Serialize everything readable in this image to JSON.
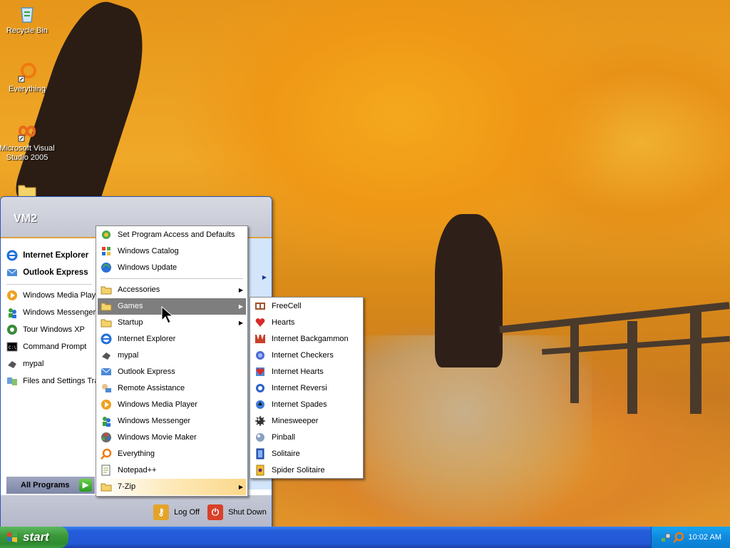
{
  "desktop": {
    "icons": [
      {
        "label": "Recycle Bin",
        "icon": "recycle-bin-icon"
      },
      {
        "label": "Everything",
        "icon": "everything-search-icon"
      },
      {
        "label": "Microsoft Visual Studio 2005",
        "icon": "visual-studio-icon"
      },
      {
        "label": "",
        "icon": "folder-icon"
      }
    ]
  },
  "start_menu": {
    "user": "VM2",
    "pinned": [
      {
        "label": "Internet Explorer",
        "icon": "internet-explorer-icon"
      },
      {
        "label": "Outlook Express",
        "icon": "outlook-express-icon"
      }
    ],
    "recent": [
      {
        "label": "Windows Media Player",
        "icon": "media-player-icon"
      },
      {
        "label": "Windows Messenger",
        "icon": "messenger-icon"
      },
      {
        "label": "Tour Windows XP",
        "icon": "tour-icon"
      },
      {
        "label": "Command Prompt",
        "icon": "command-prompt-icon"
      },
      {
        "label": "mypal",
        "icon": "mypal-icon"
      },
      {
        "label": "Files and Settings Transfer Wizard",
        "icon": "transfer-wizard-icon"
      }
    ],
    "all_programs": "All Programs",
    "log_off": "Log Off",
    "shut_down": "Shut Down"
  },
  "programs_menu": {
    "top": [
      {
        "label": "Set Program Access and Defaults",
        "icon": "program-access-icon"
      },
      {
        "label": "Windows Catalog",
        "icon": "windows-catalog-icon"
      },
      {
        "label": "Windows Update",
        "icon": "windows-update-icon"
      }
    ],
    "items": [
      {
        "label": "Accessories",
        "icon": "folder-icon",
        "submenu": true
      },
      {
        "label": "Games",
        "icon": "folder-icon",
        "submenu": true
      },
      {
        "label": "Startup",
        "icon": "folder-icon",
        "submenu": true
      },
      {
        "label": "Internet Explorer",
        "icon": "internet-explorer-icon"
      },
      {
        "label": "mypal",
        "icon": "mypal-icon"
      },
      {
        "label": "Outlook Express",
        "icon": "outlook-express-icon"
      },
      {
        "label": "Remote Assistance",
        "icon": "remote-assistance-icon"
      },
      {
        "label": "Windows Media Player",
        "icon": "media-player-icon"
      },
      {
        "label": "Windows Messenger",
        "icon": "messenger-icon"
      },
      {
        "label": "Windows Movie Maker",
        "icon": "movie-maker-icon"
      },
      {
        "label": "Everything",
        "icon": "everything-search-icon"
      },
      {
        "label": "Notepad++",
        "icon": "notepadpp-icon"
      },
      {
        "label": "7-Zip",
        "icon": "folder-icon",
        "submenu": true
      }
    ]
  },
  "games_menu": {
    "items": [
      {
        "label": "FreeCell",
        "icon": "freecell-icon"
      },
      {
        "label": "Hearts",
        "icon": "hearts-icon"
      },
      {
        "label": "Internet Backgammon",
        "icon": "backgammon-icon"
      },
      {
        "label": "Internet Checkers",
        "icon": "checkers-icon"
      },
      {
        "label": "Internet Hearts",
        "icon": "internet-hearts-icon"
      },
      {
        "label": "Internet Reversi",
        "icon": "reversi-icon"
      },
      {
        "label": "Internet Spades",
        "icon": "spades-icon"
      },
      {
        "label": "Minesweeper",
        "icon": "minesweeper-icon"
      },
      {
        "label": "Pinball",
        "icon": "pinball-icon"
      },
      {
        "label": "Solitaire",
        "icon": "solitaire-icon"
      },
      {
        "label": "Spider Solitaire",
        "icon": "spider-solitaire-icon"
      }
    ]
  },
  "taskbar": {
    "start_label": "start",
    "clock": "10:02 AM"
  },
  "colors": {
    "menu_highlight": "#316ac5",
    "taskbar_blue": "#245edb",
    "start_green": "#3c9a3c",
    "tray_blue": "#0e8ae0"
  }
}
